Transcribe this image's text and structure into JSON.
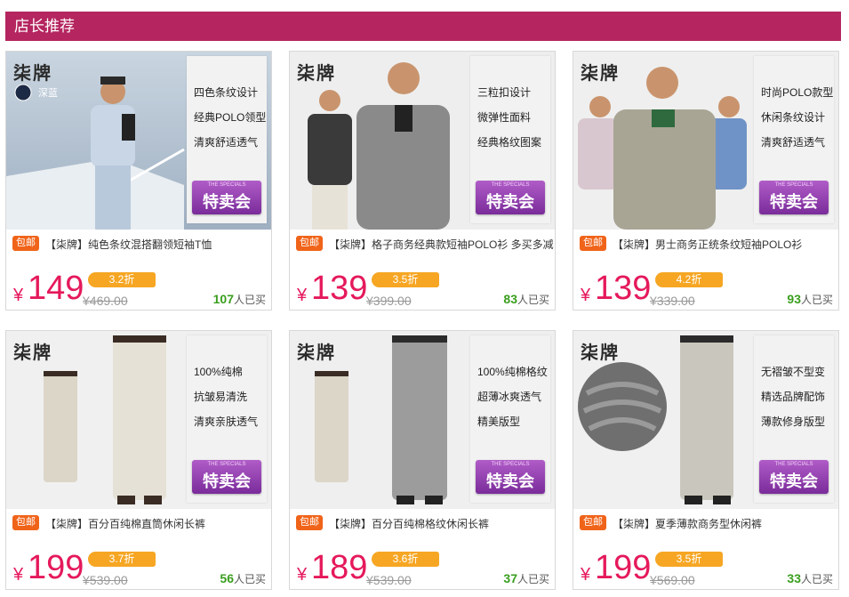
{
  "header": {
    "title": "店长推荐"
  },
  "colors": {
    "header": "#b5255f",
    "price": "#e5195b",
    "discount": "#f6a623",
    "baoyou": "#f0641a",
    "sold_count": "#3a9e1e"
  },
  "products": [
    {
      "brand": "柒牌",
      "color_label": "深蓝",
      "features": [
        "四色条纹设计",
        "经典POLO领型",
        "清爽舒适透气"
      ],
      "badge_small": "THE SPECIALS",
      "badge_text": "特卖会",
      "baoyou": "包邮",
      "title": "【柒牌】纯色条纹混搭翻领短袖T恤",
      "currency": "¥",
      "price": "149",
      "discount": "3.2折",
      "original_price": "¥469.00",
      "sold_count": "107",
      "sold_suffix": "人已买"
    },
    {
      "brand": "柒牌",
      "features": [
        "三粒扣设计",
        "微弹性面料",
        "经典格纹图案"
      ],
      "badge_small": "THE SPECIALS",
      "badge_text": "特卖会",
      "baoyou": "包邮",
      "title": "【柒牌】格子商务经典款短袖POLO衫 多买多减",
      "currency": "¥",
      "price": "139",
      "discount": "3.5折",
      "original_price": "¥399.00",
      "sold_count": "83",
      "sold_suffix": "人已买"
    },
    {
      "brand": "柒牌",
      "features": [
        "时尚POLO款型",
        "休闲条纹设计",
        "清爽舒适透气"
      ],
      "badge_small": "THE SPECIALS",
      "badge_text": "特卖会",
      "baoyou": "包邮",
      "title": "【柒牌】男士商务正统条纹短袖POLO衫",
      "currency": "¥",
      "price": "139",
      "discount": "4.2折",
      "original_price": "¥339.00",
      "sold_count": "93",
      "sold_suffix": "人已买"
    },
    {
      "brand": "柒牌",
      "features": [
        "100%纯棉",
        "抗皱易清洗",
        "清爽亲肤透气"
      ],
      "badge_small": "THE SPECIALS",
      "badge_text": "特卖会",
      "baoyou": "包邮",
      "title": "【柒牌】百分百纯棉直筒休闲长裤",
      "currency": "¥",
      "price": "199",
      "discount": "3.7折",
      "original_price": "¥539.00",
      "sold_count": "56",
      "sold_suffix": "人已买"
    },
    {
      "brand": "柒牌",
      "features": [
        "100%纯棉格纹",
        "超薄冰爽透气",
        "精美版型"
      ],
      "badge_small": "THE SPECIALS",
      "badge_text": "特卖会",
      "baoyou": "包邮",
      "title": "【柒牌】百分百纯棉格纹休闲长裤",
      "currency": "¥",
      "price": "189",
      "discount": "3.6折",
      "original_price": "¥539.00",
      "sold_count": "37",
      "sold_suffix": "人已买"
    },
    {
      "brand": "柒牌",
      "features": [
        "无褶皱不型变",
        "精选品牌配饰",
        "薄款修身版型"
      ],
      "badge_small": "THE SPECIALS",
      "badge_text": "特卖会",
      "baoyou": "包邮",
      "title": "【柒牌】夏季薄款商务型休闲裤",
      "currency": "¥",
      "price": "199",
      "discount": "3.5折",
      "original_price": "¥569.00",
      "sold_count": "33",
      "sold_suffix": "人已买"
    }
  ]
}
